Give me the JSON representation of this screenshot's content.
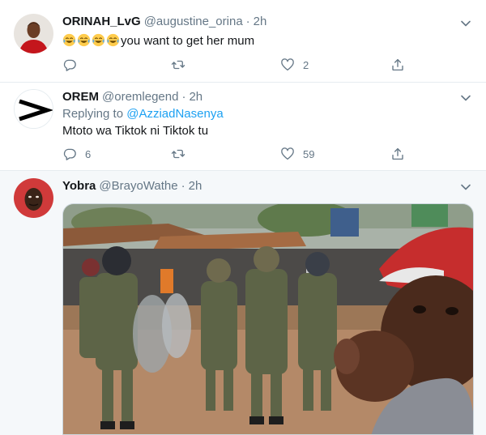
{
  "tweets": [
    {
      "name": "ORINAH_LvG",
      "handle": "@augustine_orina",
      "separator": "·",
      "time": "2h",
      "text": "you want to get her mum",
      "emoji": [
        "face-with-tears-of-joy",
        "face-with-tears-of-joy",
        "face-with-tears-of-joy",
        "face-with-tears-of-joy"
      ],
      "replies": "",
      "retweets": "",
      "likes": "2"
    },
    {
      "name": "OREM",
      "handle": "@oremlegend",
      "separator": "·",
      "time": "2h",
      "replying_to_label": "Replying to",
      "replying_to_mention": "@AzziadNasenya",
      "text": "Mtoto wa Tiktok ni Tiktok tu",
      "replies": "6",
      "retweets": "",
      "likes": "59"
    },
    {
      "name": "Yobra",
      "handle": "@BrayoWathe",
      "separator": "·",
      "time": "2h",
      "media": "meme photo: police officers in riot gear marching, child in red cap pointing at viewer"
    }
  ],
  "colors": {
    "accent": "#1da1f2",
    "muted": "#657786",
    "text": "#14171a",
    "border": "#e6ecf0",
    "highlight_bg": "#f5f8fa"
  },
  "icons": {
    "reply": "reply-icon",
    "retweet": "retweet-icon",
    "like": "heart-icon",
    "share": "share-icon",
    "more": "chevron-down-icon"
  }
}
